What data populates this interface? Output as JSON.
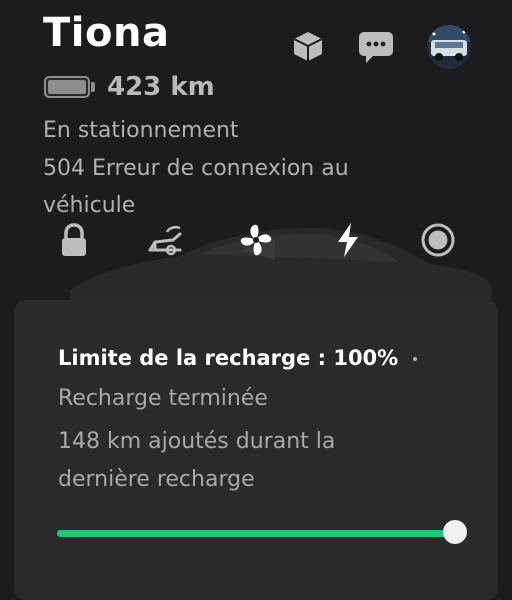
{
  "vehicle": {
    "name": "Tiona",
    "range": "423 km",
    "battery_level": 1.0
  },
  "status": {
    "parking": "En stationnement",
    "error_line1": "504 Erreur de connexion au",
    "error_line2": "véhicule"
  },
  "top_icons": [
    "package-icon",
    "chat-icon",
    "avatar"
  ],
  "controls": [
    "lock-icon",
    "trunk-icon",
    "fan-icon",
    "charge-icon",
    "sentry-icon"
  ],
  "charging": {
    "limit_label": "Limite de la recharge : 100%",
    "state": "Recharge terminée",
    "added_line1": "148 km ajoutés durant la",
    "added_line2": "dernière recharge",
    "limit_fraction": 1.0
  },
  "colors": {
    "background": "#1c1c1e",
    "card": "#2a2a2c",
    "accent_green": "#22c873"
  }
}
